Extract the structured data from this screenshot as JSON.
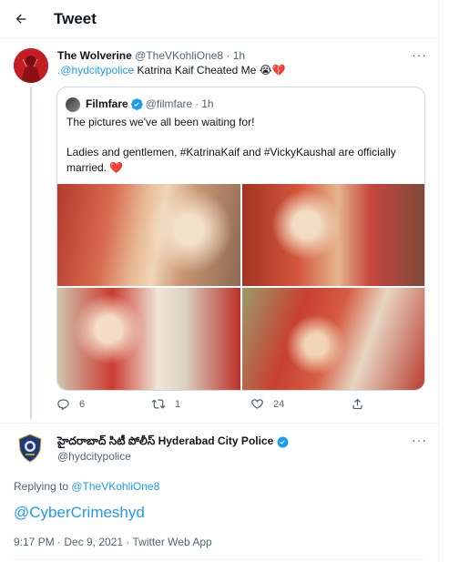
{
  "header": {
    "title": "Tweet",
    "back_icon": "arrow-left-icon"
  },
  "reply_tweet": {
    "display_name": "The Wolverine",
    "handle": "@TheVKohliOne8",
    "separator": "·",
    "time": "1h",
    "mention": ".@hydcitypolice",
    "text": " Katrina Kaif Cheated Me",
    "emoji1": "😭",
    "emoji2": "💔",
    "more": "···"
  },
  "quoted_tweet": {
    "display_name": "Filmfare",
    "handle": "@filmfare",
    "separator": "·",
    "time": "1h",
    "line1": "The pictures we've all been waiting for!",
    "line2": "Ladies and gentlemen, #KatrinaKaif and #VickyKaushal are officially married.",
    "heart": "❤️"
  },
  "actions": {
    "replies": "6",
    "retweets": "1",
    "likes": "24"
  },
  "main_tweet": {
    "display_name": "హైదరాబాద్ సిటీ పోలీస్ Hyderabad City Police",
    "handle": "@hydcitypolice",
    "more": "···",
    "replying_prefix": "Replying to ",
    "replying_to": "@TheVKohliOne8",
    "text": "@CyberCrimeshyd",
    "meta": "9:17 PM · Dec 9, 2021 · Twitter Web App"
  },
  "colors": {
    "accent": "#1d9bf0",
    "text": "#0f1419",
    "muted": "#536471",
    "border": "#cfd9de"
  }
}
